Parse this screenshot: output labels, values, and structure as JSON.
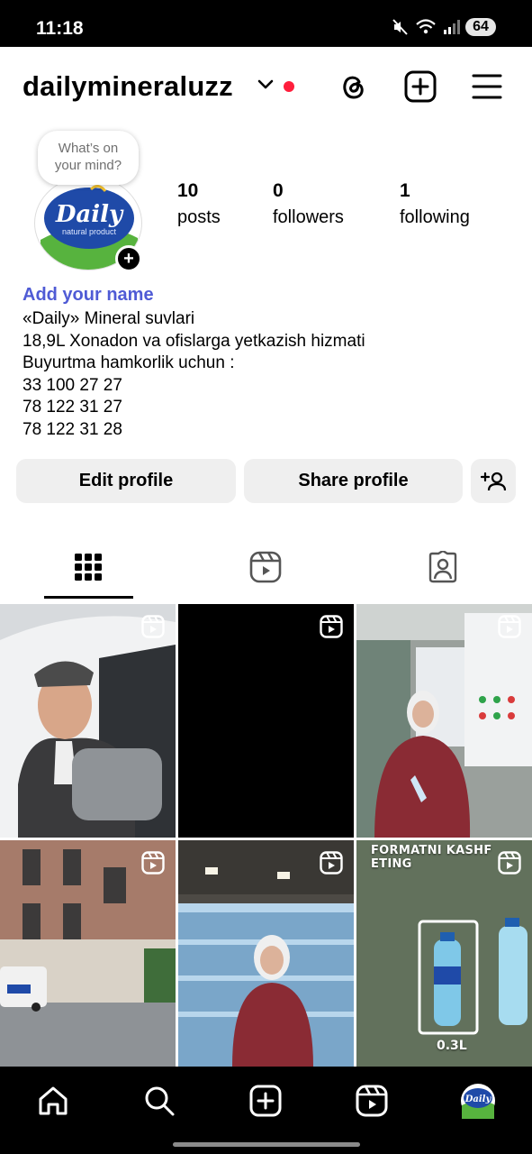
{
  "status_bar": {
    "time": "11:18",
    "battery": "64"
  },
  "header": {
    "username": "dailymineraluzz"
  },
  "note": {
    "text_line1": "What’s on",
    "text_line2": "your mind?"
  },
  "avatar": {
    "brand_text": "Daily",
    "brand_sub": "natural product"
  },
  "stats": [
    {
      "value": "10",
      "label": "posts"
    },
    {
      "value": "0",
      "label": "followers"
    },
    {
      "value": "1",
      "label": "following"
    }
  ],
  "bio": {
    "add_name": "Add your name",
    "lines": [
      "«Daily» Mineral suvlari",
      "18,9L Xonadon va ofislarga yetkazish hizmati",
      "Buyurtma hamkorlik uchun :",
      "33 100 27 27",
      "78 122 31 27",
      "78 122 31 28"
    ]
  },
  "buttons": {
    "edit_profile": "Edit profile",
    "share_profile": "Share profile"
  },
  "grid": {
    "post6_caption": "FORMATNI KASHF ETING",
    "post6_size": "0.3L"
  },
  "icons": {
    "threads": "threads-icon",
    "create": "plus-square-icon",
    "menu": "hamburger-menu-icon",
    "grid_tab": "grid-icon",
    "reels_tab": "reels-icon",
    "tagged_tab": "tagged-icon",
    "nav": [
      "home-icon",
      "search-icon",
      "create-icon",
      "reels-icon",
      "profile-avatar"
    ]
  },
  "colors": {
    "link_blue": "#4f5bd5",
    "notification_red": "#ff1e3c",
    "brand_blue": "#1f4aa8",
    "brand_green": "#57b33e"
  }
}
